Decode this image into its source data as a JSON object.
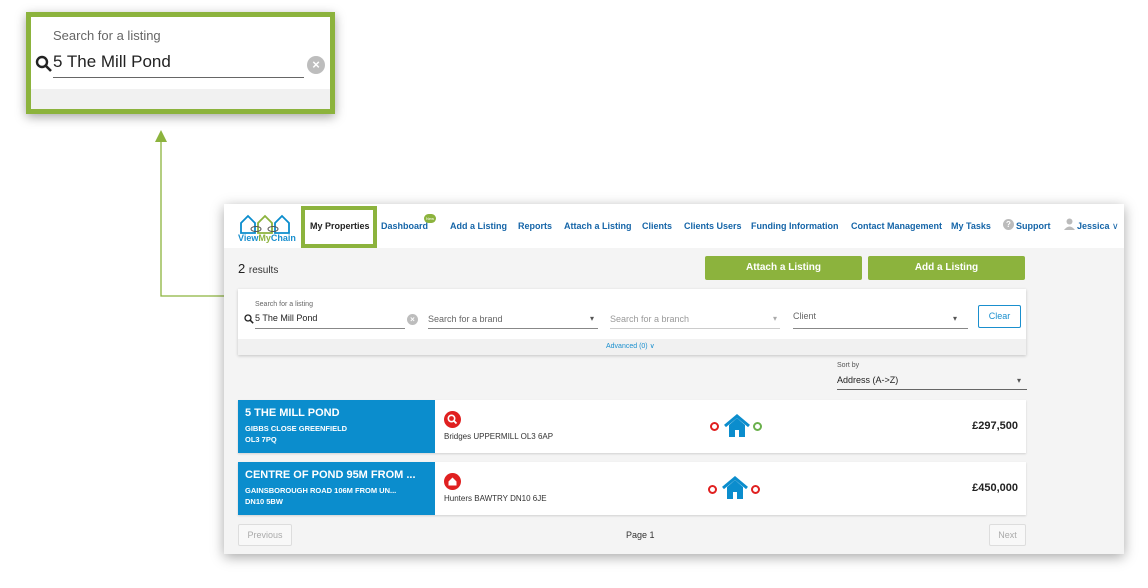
{
  "callout": {
    "label": "Search for a listing",
    "value": "5 The Mill Pond",
    "clear_symbol": "×"
  },
  "nav": {
    "logo": {
      "view": "View",
      "my": "My",
      "chain": "Chain"
    },
    "active": "My Properties",
    "items": [
      "Dashboard",
      "Add a Listing",
      "Reports",
      "Attach a Listing",
      "Clients",
      "Clients Users",
      "Funding Information",
      "Contact Management",
      "My Tasks"
    ],
    "new_badge": "New",
    "support": "Support",
    "user": "Jessica"
  },
  "results": {
    "count": "2",
    "label": "results"
  },
  "buttons": {
    "attach": "Attach a Listing",
    "add": "Add a Listing"
  },
  "filters": {
    "search_label": "Search for a listing",
    "search_value": "5 The Mill Pond",
    "brand_placeholder": "Search for a brand",
    "branch_placeholder": "Search for a branch",
    "client_placeholder": "Client",
    "clear_label": "Clear",
    "advanced": "Advanced (0)"
  },
  "sort": {
    "label": "Sort by",
    "value": "Address (A->Z)"
  },
  "rows": [
    {
      "title": "5 THE MILL POND",
      "line1": "GIBBS CLOSE GREENFIELD",
      "line2": "OL3 7PQ",
      "agent": "Bridges UPPERMILL OL3 6AP",
      "agent_icon": "search-icon",
      "price": "£297,500",
      "status_left": "red",
      "status_right": "green"
    },
    {
      "title": "CENTRE OF POND 95M FROM ...",
      "line1": "GAINSBOROUGH ROAD 106M FROM UN...",
      "line2": "DN10 5BW",
      "agent": "Hunters BAWTRY DN10 6JE",
      "agent_icon": "home-icon",
      "price": "£450,000",
      "status_left": "red",
      "status_right": "red"
    }
  ],
  "pagination": {
    "previous": "Previous",
    "page": "Page 1",
    "next": "Next"
  },
  "colors": {
    "accent_green": "#8cb33d",
    "brand_blue": "#0b8dcd",
    "nav_link": "#1565a8",
    "status_red": "#e02020",
    "status_green": "#6ab04c"
  }
}
